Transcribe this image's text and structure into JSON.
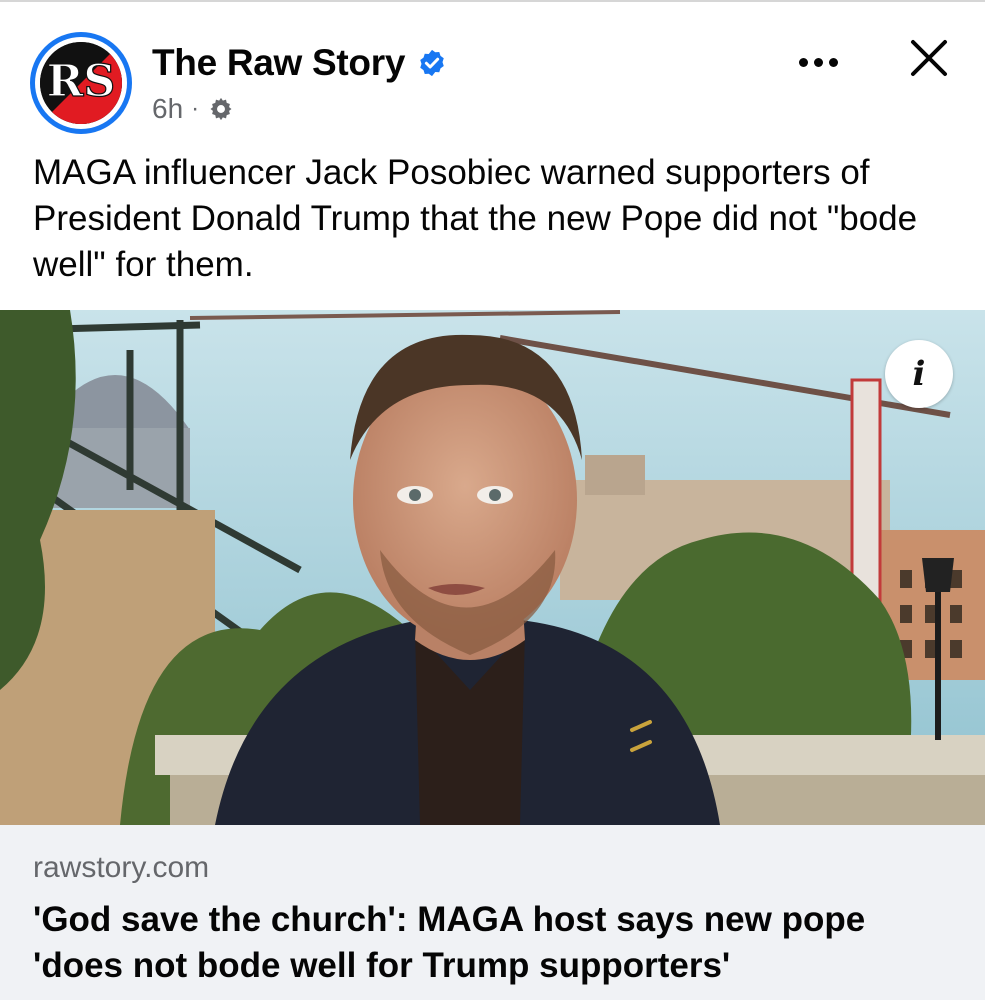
{
  "post": {
    "page_name": "The Raw Story",
    "avatar_initials": "RS",
    "time": "6h",
    "separator": "·",
    "caption": "MAGA influencer Jack Posobiec warned supporters of President Donald Trump that the new Pope did not \"bode well\" for them.",
    "info_symbol": "i"
  },
  "link": {
    "domain": "rawstory.com",
    "headline": "'God save the church': MAGA host says new pope 'does not bode well for Trump supporters'"
  },
  "icons": {
    "verified": "verified-badge-icon",
    "audience": "gear-icon",
    "more": "more-dots-icon",
    "close": "close-icon",
    "info": "info-icon"
  },
  "colors": {
    "brand_blue": "#1877f2",
    "avatar_red": "#e11b22",
    "muted_text": "#65676b",
    "link_bg": "#f0f2f5"
  }
}
